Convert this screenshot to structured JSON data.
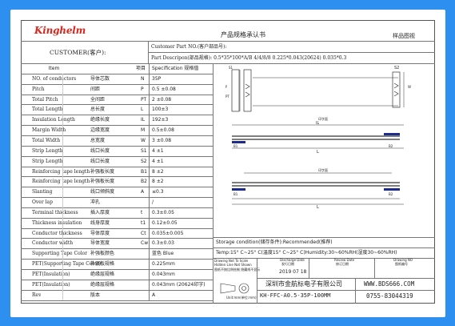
{
  "header": {
    "logo": "Kinghelm",
    "title": "产品规格承认书",
    "corner": "样品图视"
  },
  "customer": {
    "label": "CUSTOMER(客户):",
    "part_no_label": "Customer Part NO.(客户部品号):",
    "part_desc_label": "Part Descripon(部品规格):",
    "part_desc_value": "0.5*35*100*A/B   4/4/8/8 0.225*0.043(20624)   0.035*0.3"
  },
  "table": {
    "col_headers": [
      "Item",
      "项目",
      "Specification  规格值"
    ],
    "rows": [
      {
        "en": "NO. of conductors",
        "cn": "导体芯数",
        "sym": "N",
        "val": "35P"
      },
      {
        "en": "Pitch",
        "cn": "间距",
        "sym": "P",
        "val": "0.5 ±0.08"
      },
      {
        "en": "Total Pitch",
        "cn": "全间距",
        "sym": "PT",
        "val": "2 ±0.08"
      },
      {
        "en": "Total Length",
        "cn": "总长度",
        "sym": "L",
        "val": "100±3"
      },
      {
        "en": "Insulation Length",
        "cn": "绝缘长度",
        "sym": "IL",
        "val": "192±3"
      },
      {
        "en": "Margin Width",
        "cn": "边缘宽度",
        "sym": "M",
        "val": "0.5±0.08"
      },
      {
        "en": "Total Width",
        "cn": "总宽度",
        "sym": "W",
        "val": "3 ±0.08"
      },
      {
        "en": "Strip Length",
        "cn": "线口长度",
        "sym": "S1",
        "val": "4 ±1"
      },
      {
        "en": "Strip Length",
        "cn": "线口长度",
        "sym": "S2",
        "val": "4 ±1"
      },
      {
        "en": "Reinforcing tape length",
        "cn": "补强板长度",
        "sym": "B1",
        "val": "8 ±2"
      },
      {
        "en": "Reinforcing tape length",
        "cn": "补强板长度",
        "sym": "B2",
        "val": "8 ±2"
      },
      {
        "en": "Slanting",
        "cn": "线口倾斜度",
        "sym": "A",
        "val": "≤0.3"
      },
      {
        "en": "Over lap",
        "cn": "冲孔",
        "sym": "",
        "val": "/"
      },
      {
        "en": "Terminal thickness",
        "cn": "插入厚度",
        "sym": "t",
        "val": "0.3±0.05"
      },
      {
        "en": "Thickness insulation",
        "cn": "线身厚度",
        "sym": "t1",
        "val": "0.12±0.05"
      },
      {
        "en": "Conductor thickness",
        "cn": "导体厚度",
        "sym": "Ct",
        "val": "0.035±0.005"
      },
      {
        "en": "Conductor width",
        "cn": "导体宽度",
        "sym": "Cw",
        "val": "0.3±0.03"
      },
      {
        "en": "Supporting Tape Color",
        "cn": "补强板颜色",
        "sym": "",
        "val": "蓝色 Blue"
      },
      {
        "en": "PET(Supporting Tape Color)",
        "cn": "补强板规格",
        "sym": "",
        "val": "0.225mm"
      },
      {
        "en": "PET(Insulation)",
        "cn": "绝缘层规格",
        "sym": "",
        "val": "0.043mm"
      },
      {
        "en": "PET(Insulation)",
        "cn": "绝缘层规格",
        "sym": "",
        "val": "0.043mm (20624印字)"
      },
      {
        "en": "Rev",
        "cn": "版本",
        "sym": "",
        "val": "A"
      }
    ]
  },
  "drawing": {
    "labels": {
      "s1": "S1",
      "s2": "S2",
      "p": "P",
      "w": "W",
      "pt": "PT",
      "il": "IL",
      "l": "L",
      "b1": "B1",
      "b2": "B2",
      "print1": "印字面",
      "print2": "印字面"
    }
  },
  "storage": {
    "condition": "Storage condition(储存条件):Recommended(推荐)",
    "temp": "Temp:15° C~25° C(温度15° C~25° C)Humidity:30~60%RH(湿度30~60%RH)"
  },
  "title_block": {
    "drawing_note_1": "Drawing Not To Scale",
    "drawing_note_2": "Hidden Line Not Shown",
    "drawing_note_3": "图纸不按比例绘制 隐藏线不显示",
    "unit_note": "Unit:mm(单位:mm)",
    "design_date_label": "Discharge Date",
    "design_date_label_cn": "发行日期",
    "review_date_label": "Review Date",
    "review_date_label_cn": "修订日期",
    "drawing_no_label": "Drawing NO",
    "drawing_no_label_cn": "图纸编号",
    "date": "2019 07 18",
    "company": "深圳市金航标电子有限公司",
    "website": "WWW.BDS666.COM",
    "part_code": "KH-FFC-A0.5-35P-100MM",
    "phone": "0755-83044319"
  }
}
